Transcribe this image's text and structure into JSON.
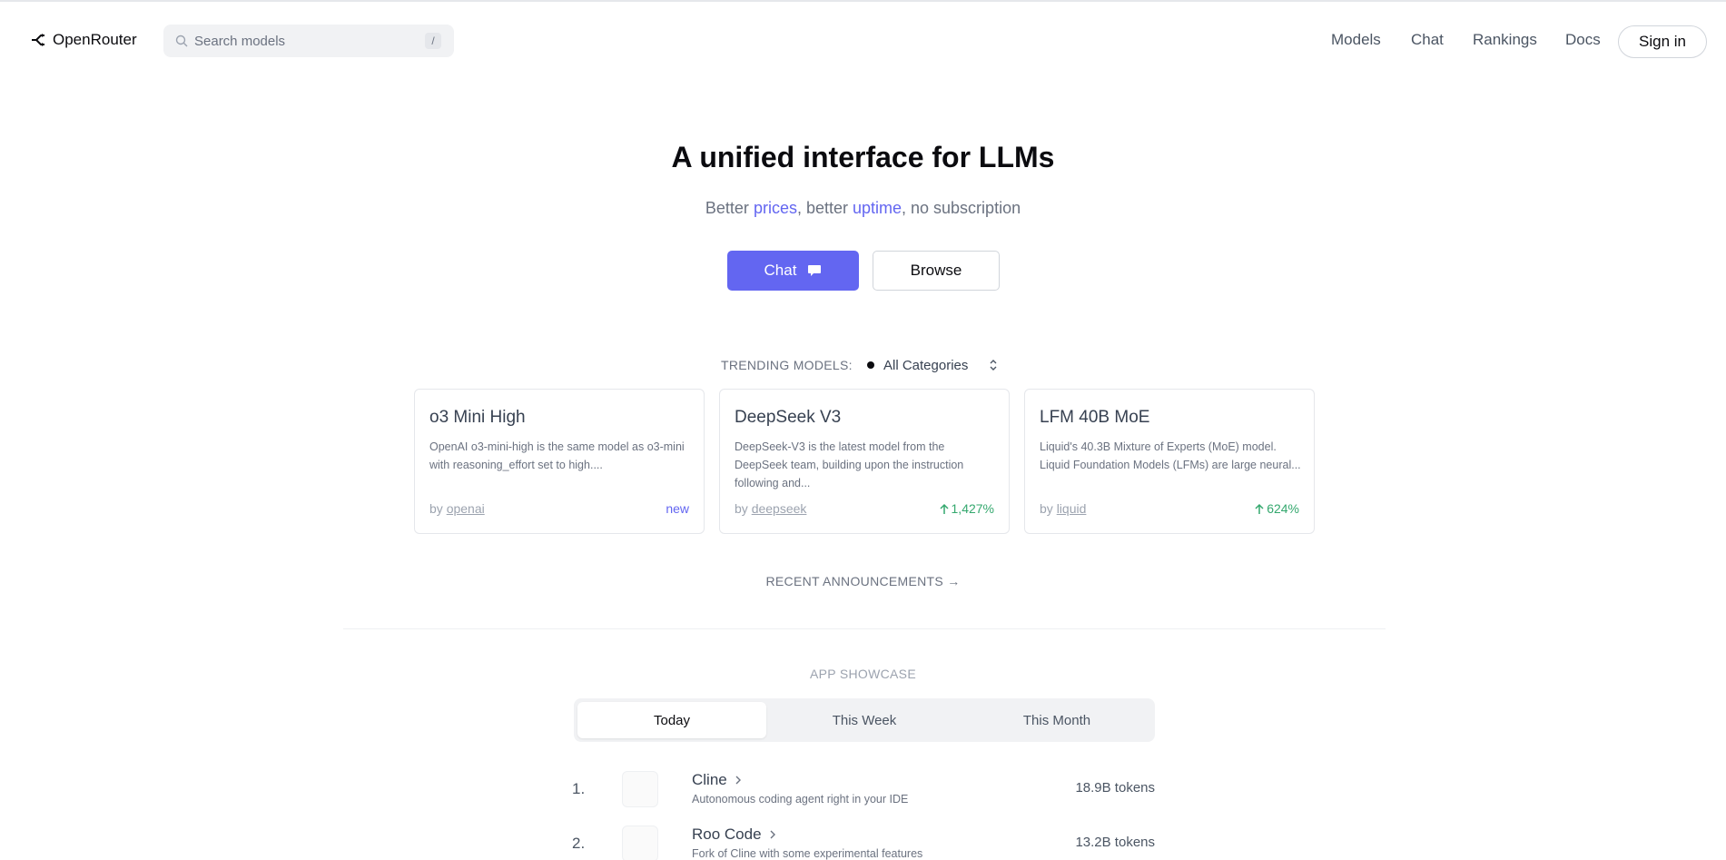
{
  "brand": {
    "name": "OpenRouter"
  },
  "search": {
    "placeholder": "Search models",
    "shortcut": "/"
  },
  "nav": [
    {
      "label": "Models"
    },
    {
      "label": "Chat"
    },
    {
      "label": "Rankings"
    },
    {
      "label": "Docs"
    }
  ],
  "signin_label": "Sign in",
  "hero": {
    "title": "A unified interface for LLMs",
    "sub_pre": "Better ",
    "sub_link1": "prices",
    "sub_mid": ", better ",
    "sub_link2": "uptime",
    "sub_post": ", no subscription",
    "chat_label": "Chat",
    "browse_label": "Browse"
  },
  "trending": {
    "label": "TRENDING MODELS:",
    "category": "All Categories",
    "cards": [
      {
        "title": "o3 Mini High",
        "desc": "OpenAI o3-mini-high is the same model as o3-mini with reasoning_effort set to high....",
        "by": "by ",
        "author": "openai",
        "badge": "new"
      },
      {
        "title": "DeepSeek V3",
        "desc": "DeepSeek-V3 is the latest model from the DeepSeek team, building upon the instruction following and...",
        "by": "by ",
        "author": "deepseek",
        "badge": "1,427%"
      },
      {
        "title": "LFM 40B MoE",
        "desc": "Liquid's 40.3B Mixture of Experts (MoE) model. Liquid Foundation Models (LFMs) are large neural...",
        "by": "by ",
        "author": "liquid",
        "badge": "624%"
      }
    ]
  },
  "announcements_label": "RECENT ANNOUNCEMENTS →",
  "showcase": {
    "label": "APP SHOWCASE",
    "tabs": [
      {
        "label": "Today"
      },
      {
        "label": "This Week"
      },
      {
        "label": "This Month"
      }
    ],
    "apps": [
      {
        "rank": "1.",
        "name": "Cline",
        "desc": "Autonomous coding agent right in your IDE",
        "tokens": "18.9B tokens"
      },
      {
        "rank": "2.",
        "name": "Roo Code",
        "desc": "Fork of Cline with some experimental features",
        "tokens": "13.2B tokens"
      }
    ]
  },
  "colors": {
    "accent": "#6366f1",
    "trend_up": "#34a86e"
  }
}
